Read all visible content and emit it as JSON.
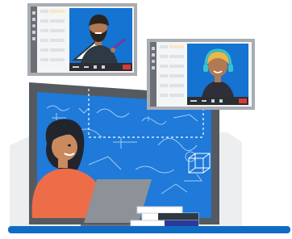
{
  "colors": {
    "board_blue": "#1f7ad9",
    "board_frame": "#555a61",
    "wall": "#e3e5e7",
    "desk_blue": "#0f6cc4",
    "call_bg": "#1573d1",
    "window_frame": "#a9adb2",
    "end_call": "#d9392f",
    "shirt": "#ee6d49",
    "laptop": "#8d9298",
    "hair": "#22252c"
  },
  "icons": {
    "video_call_1": "man-presenter-icon",
    "video_call_2": "woman-headset-icon",
    "end_call": "phone-hang-up-icon"
  }
}
